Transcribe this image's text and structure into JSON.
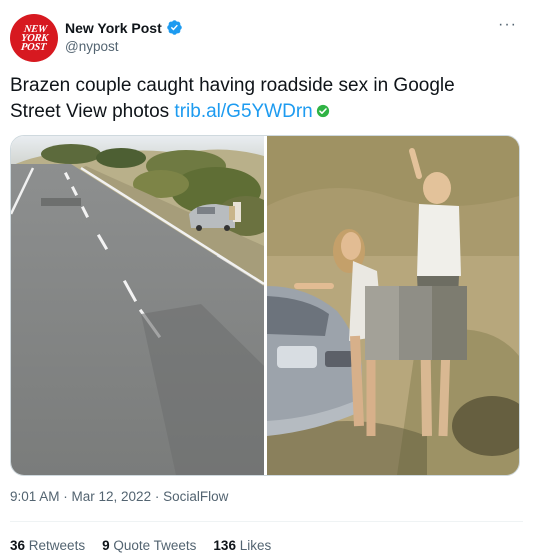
{
  "author": {
    "display_name": "New York Post",
    "handle": "@nypost",
    "logo_lines": [
      "NEW",
      "YORK",
      "POST"
    ]
  },
  "more_label": "···",
  "tweet": {
    "text": "Brazen couple caught having roadside sex in Google Street View photos ",
    "link": "trib.al/G5YWDrn"
  },
  "timestamp": "9:01 AM · Mar 12, 2022 · SocialFlow",
  "stats": {
    "retweets_count": "36",
    "retweets_label": "Retweets",
    "quotes_count": "9",
    "quotes_label": "Quote Tweets",
    "likes_count": "136",
    "likes_label": "Likes"
  },
  "colors": {
    "brand_red": "#d71920",
    "link_blue": "#1d9bf0",
    "verified_blue": "#1d9bf0",
    "muted": "#536471"
  },
  "icons": [
    "verified-badge-icon",
    "more-icon",
    "green-check-icon"
  ]
}
